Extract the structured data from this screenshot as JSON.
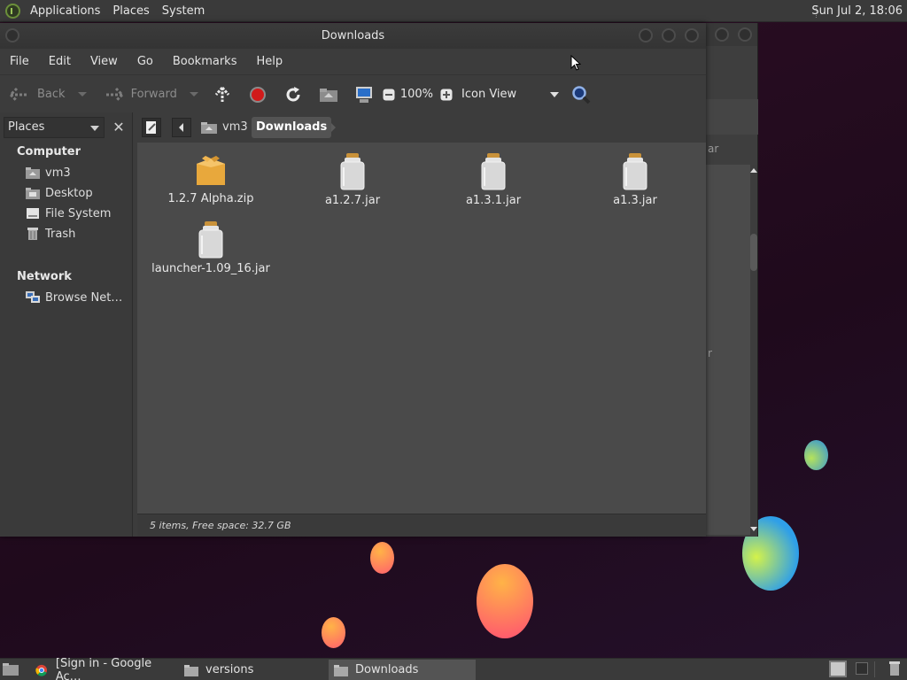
{
  "top_panel": {
    "menus": [
      "Applications",
      "Places",
      "System"
    ],
    "clock": "Sun Jul  2, 18:06"
  },
  "window": {
    "title": "Downloads",
    "menu": [
      "File",
      "Edit",
      "View",
      "Go",
      "Bookmarks",
      "Help"
    ],
    "toolbar": {
      "back": "Back",
      "forward": "Forward",
      "zoom": "100%",
      "view_mode": "Icon View"
    },
    "sidebar": {
      "selector": "Places",
      "sections": [
        {
          "title": "Computer",
          "items": [
            {
              "label": "vm3",
              "icon": "home-folder-icon"
            },
            {
              "label": "Desktop",
              "icon": "desktop-folder-icon"
            },
            {
              "label": "File System",
              "icon": "drive-icon"
            },
            {
              "label": "Trash",
              "icon": "trash-icon"
            }
          ]
        },
        {
          "title": "Network",
          "items": [
            {
              "label": "Browse Net…",
              "icon": "network-icon"
            }
          ]
        }
      ]
    },
    "path": {
      "crumbs": [
        "vm3",
        "Downloads"
      ]
    },
    "files": [
      {
        "name": "1.2.7 Alpha.zip",
        "icon": "archive-icon"
      },
      {
        "name": "a1.2.7.jar",
        "icon": "jar-icon"
      },
      {
        "name": "a1.3.1.jar",
        "icon": "jar-icon"
      },
      {
        "name": "a1.3.jar",
        "icon": "jar-icon"
      },
      {
        "name": "launcher-1.09_16.jar",
        "icon": "jar-icon"
      }
    ],
    "status": "5 items, Free space: 32.7 GB"
  },
  "background_window": {
    "fragments": [
      "ar",
      "r"
    ]
  },
  "taskbar": {
    "tasks": [
      {
        "label": "[Sign in - Google Ac…",
        "icon": "chrome-icon",
        "active": false
      },
      {
        "label": "versions",
        "icon": "folder-icon",
        "active": false
      },
      {
        "label": "Downloads",
        "icon": "folder-icon",
        "active": true
      }
    ]
  },
  "colors": {
    "panel": "#3a3a3a",
    "window": "#3c3c3c",
    "content": "#4a4a4a",
    "desktop": "#26101e",
    "stop": "#d11a1a"
  }
}
